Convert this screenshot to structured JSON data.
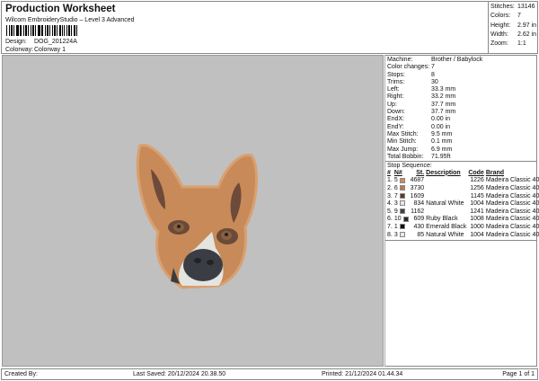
{
  "header": {
    "title": "Production Worksheet",
    "subtitle": "Wilcom EmbroideryStudio – Level 3 Advanced",
    "design_label": "Design:",
    "design": "DOG_201224A",
    "colorway_label": "Colorway:",
    "colorway": "Colorway 1"
  },
  "stats": [
    {
      "k": "Stitches:",
      "v": "13146"
    },
    {
      "k": "Colors:",
      "v": "7"
    },
    {
      "k": "Height:",
      "v": "2.97 in"
    },
    {
      "k": "Width:",
      "v": "2.62 in"
    },
    {
      "k": "Zoom:",
      "v": "1:1"
    }
  ],
  "info": [
    {
      "k": "Machine:",
      "v": "Brother / Babylock"
    },
    {
      "k": "Color changes:",
      "v": "7"
    },
    {
      "k": "Stops:",
      "v": "8"
    },
    {
      "k": "Trims:",
      "v": "30"
    },
    {
      "k": "Left:",
      "v": "33.3 mm"
    },
    {
      "k": "Right:",
      "v": "33.2 mm"
    },
    {
      "k": "Up:",
      "v": "37.7 mm"
    },
    {
      "k": "Down:",
      "v": "37.7 mm"
    },
    {
      "k": "EndX:",
      "v": "0.00 in"
    },
    {
      "k": "EndY:",
      "v": "0.00 in"
    },
    {
      "k": "Max Stitch:",
      "v": "9.5 mm"
    },
    {
      "k": "Min Stitch:",
      "v": "0.1 mm"
    },
    {
      "k": "Max Jump:",
      "v": "6.9 mm"
    },
    {
      "k": "Total Bobbin:",
      "v": "71.95ft"
    }
  ],
  "sequence": {
    "title": "Stop Sequence:",
    "headers": [
      "#",
      "N#",
      "St.",
      "Description",
      "Code",
      "Brand"
    ],
    "rows": [
      {
        "n": "1.",
        "num": "5",
        "color": "#d08a5c",
        "st": "4687",
        "desc": "",
        "code": "1226",
        "brand": "Madeira Classic 40"
      },
      {
        "n": "2.",
        "num": "6",
        "color": "#b87a52",
        "st": "3730",
        "desc": "",
        "code": "1256",
        "brand": "Madeira Classic 40"
      },
      {
        "n": "3.",
        "num": "7",
        "color": "#5a3a2c",
        "st": "1609",
        "desc": "",
        "code": "1145",
        "brand": "Madeira Classic 40"
      },
      {
        "n": "4.",
        "num": "3",
        "color": "#e6e6e6",
        "st": "834",
        "desc": "Natural White",
        "code": "1004",
        "brand": "Madeira Classic 40"
      },
      {
        "n": "5.",
        "num": "9",
        "color": "#3a4046",
        "st": "1162",
        "desc": "",
        "code": "1241",
        "brand": "Madeira Classic 40"
      },
      {
        "n": "6.",
        "num": "10",
        "color": "#2c2626",
        "st": "609",
        "desc": "Ruby Black",
        "code": "1008",
        "brand": "Madeira Classic 40"
      },
      {
        "n": "7.",
        "num": "1",
        "color": "#0c0c0c",
        "st": "430",
        "desc": "Emerald Black",
        "code": "1000",
        "brand": "Madeira Classic 40"
      },
      {
        "n": "8.",
        "num": "3",
        "color": "#e6e6e6",
        "st": "85",
        "desc": "Natural White",
        "code": "1004",
        "brand": "Madeira Classic 40"
      }
    ]
  },
  "footer": {
    "created": "Created By:",
    "saved": "Last Saved: 20/12/2024 20.38.50",
    "printed": "Printed: 21/12/2024 01.44.34",
    "page": "Page 1 of 1"
  }
}
